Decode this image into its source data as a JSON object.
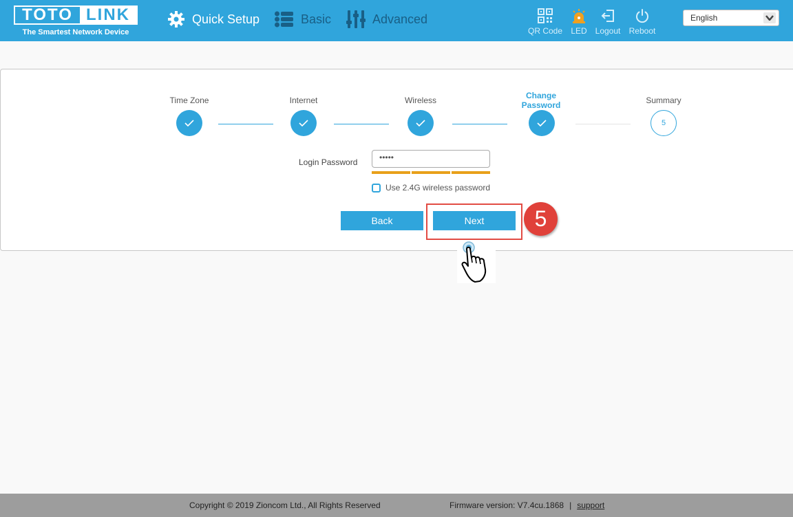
{
  "header": {
    "logo_left": "TOTO",
    "logo_right": "LINK",
    "tagline": "The Smartest Network Device",
    "nav": {
      "quick_setup": "Quick Setup",
      "basic": "Basic",
      "advanced": "Advanced"
    },
    "tools": {
      "qr_code": "QR Code",
      "led": "LED",
      "logout": "Logout",
      "reboot": "Reboot"
    },
    "language": "English",
    "colors": {
      "bar": "#30a5dc",
      "inactive_nav": "#195f86",
      "led_icon": "#f0a020"
    }
  },
  "wizard": {
    "steps": [
      {
        "label": "Time Zone",
        "state": "done"
      },
      {
        "label": "Internet",
        "state": "done"
      },
      {
        "label": "Wireless",
        "state": "done"
      },
      {
        "label_line1": "Change",
        "label_line2": "Password",
        "state": "current"
      },
      {
        "label": "Summary",
        "number": "5",
        "state": "pending"
      }
    ],
    "password_label": "Login Password",
    "password_value": "•••••",
    "strength_segments": 3,
    "checkbox_label": "Use 2.4G wireless password",
    "back_label": "Back",
    "next_label": "Next",
    "annotation_number": "5"
  },
  "footer": {
    "copyright": "Copyright © 2019 Zioncom Ltd., All Rights Reserved",
    "firmware": "Firmware version: V7.4cu.1868",
    "separator": "|",
    "support": "support"
  }
}
